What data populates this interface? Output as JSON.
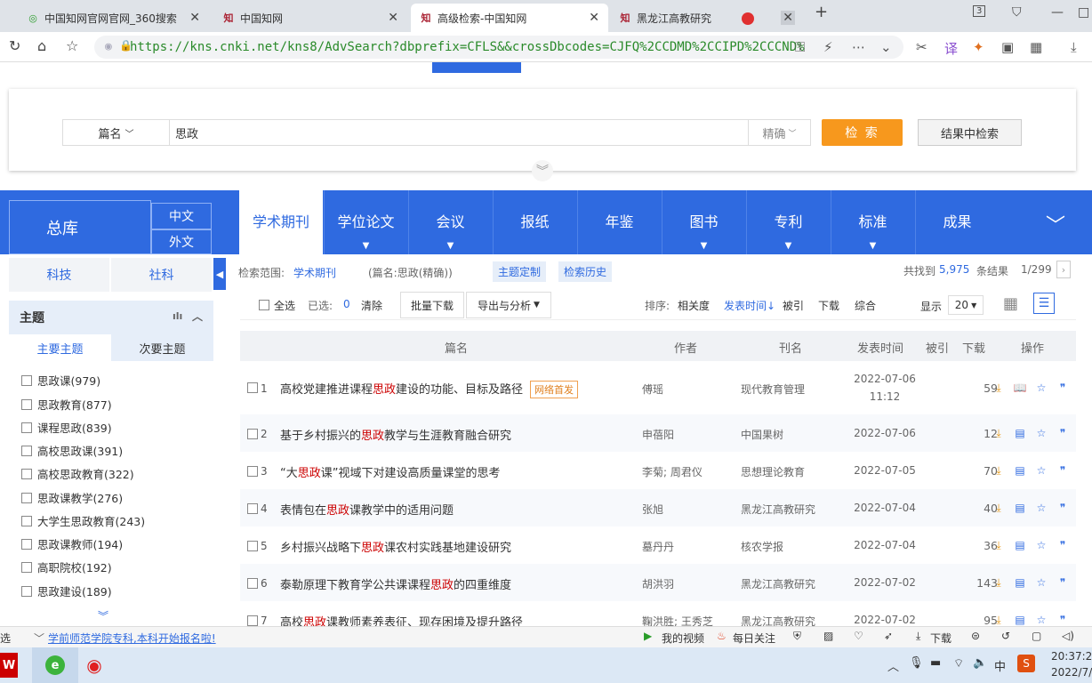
{
  "tabs": [
    {
      "label": "中国知网官网官网_360搜索",
      "icon": "search-favicon"
    },
    {
      "label": "中国知网",
      "icon": "cnki-favicon"
    },
    {
      "label": "高级检索-中国知网",
      "icon": "cnki-favicon"
    },
    {
      "label": "黑龙江高教研究",
      "icon": "cnki-favicon"
    }
  ],
  "tab_count": "3",
  "url": "https://kns.cnki.net/kns8/AdvSearch?dbprefix=CFLS&&crossDbcodes=CJFQ%2CCDMD%2CCIPD%2CCCND%",
  "search": {
    "field": "篇名",
    "term": "思政",
    "match": "精确",
    "search_btn": "检 索",
    "in_results_btn": "结果中检索"
  },
  "nav": {
    "zongku": "总库",
    "zh": "中文",
    "wai": "外文",
    "tabs": [
      "学术期刊",
      "学位论文",
      "会议",
      "报纸",
      "年鉴",
      "图书",
      "专利",
      "标准",
      "成果"
    ]
  },
  "sidebar": {
    "tab_keji": "科技",
    "tab_sheke": "社科",
    "topic": "主题",
    "sub_main": "主要主题",
    "sub_minor": "次要主题",
    "items": [
      "思政课(979)",
      "思政教育(877)",
      "课程思政(839)",
      "高校思政课(391)",
      "高校思政教育(322)",
      "思政课教学(276)",
      "大学生思政教育(243)",
      "思政课教师(194)",
      "高职院校(192)",
      "思政建设(189)"
    ]
  },
  "info": {
    "scope_label": "检索范围:",
    "scope": "学术期刊",
    "query": "(篇名:思政(精确))",
    "topic_custom": "主题定制",
    "history": "检索历史",
    "found_prefix": "共找到",
    "found": "5,975",
    "found_suffix": "条结果",
    "page": "1/299"
  },
  "toolbar": {
    "select_all": "全选",
    "selected_label": "已选:",
    "selected": "0",
    "clear": "清除",
    "batch_download": "批量下载",
    "export": "导出与分析",
    "sort_label": "排序:",
    "sort_rel": "相关度",
    "sort_time": "发表时间",
    "sort_cited": "被引",
    "sort_dl": "下载",
    "sort_comp": "综合",
    "show_label": "显示",
    "show_count": "20"
  },
  "table": {
    "headers": {
      "title": "篇名",
      "author": "作者",
      "journal": "刊名",
      "date": "发表时间",
      "cited": "被引",
      "downloads": "下载",
      "ops": "操作"
    },
    "rows": [
      {
        "num": "1",
        "pre": "高校党建推进课程",
        "hl": "思政",
        "post": "建设的功能、目标及路径",
        "badge": "网络首发",
        "author": "傅瑶",
        "journal": "现代教育管理",
        "date": "2022-07-06",
        "time": "11:12",
        "downloads": "59"
      },
      {
        "num": "2",
        "pre": "基于乡村振兴的",
        "hl": "思政",
        "post": "教学与生涯教育融合研究",
        "author": "申蓓阳",
        "journal": "中国果树",
        "date": "2022-07-06",
        "downloads": "12"
      },
      {
        "num": "3",
        "pre": "“大",
        "hl": "思政",
        "post": "课”视域下对建设高质量课堂的思考",
        "author": "李菊; 周君仪",
        "journal": "思想理论教育",
        "date": "2022-07-05",
        "downloads": "70"
      },
      {
        "num": "4",
        "pre": "表情包在",
        "hl": "思政",
        "post": "课教学中的适用问题",
        "author": "张旭",
        "journal": "黑龙江高教研究",
        "date": "2022-07-04",
        "downloads": "40"
      },
      {
        "num": "5",
        "pre": "乡村振兴战略下",
        "hl": "思政",
        "post": "课农村实践基地建设研究",
        "author": "墓丹丹",
        "journal": "核农学报",
        "date": "2022-07-04",
        "downloads": "36"
      },
      {
        "num": "6",
        "pre": "泰勒原理下教育学公共课课程",
        "hl": "思政",
        "post": "的四重维度",
        "author": "胡洪羽",
        "journal": "黑龙江高教研究",
        "date": "2022-07-02",
        "downloads": "143"
      },
      {
        "num": "7",
        "pre": "高校",
        "hl": "思政",
        "post": "课教师素养表征、现存困境及提升路径",
        "author": "鞠洪胜; 王秀芝",
        "journal": "黑龙江高教研究",
        "date": "2022-07-02",
        "downloads": "95"
      }
    ]
  },
  "status": {
    "left": "选",
    "news": "学前师范学院专科,本科开始报名啦!",
    "video": "我的视频",
    "follow": "每日关注",
    "download": "下载"
  },
  "taskbar": {
    "time": "20:37:27",
    "date": "2022/7/",
    "ime": "中"
  },
  "colors": {
    "primary": "#2f6ae0",
    "orange": "#f7981d",
    "highlight": "#cc0000"
  }
}
